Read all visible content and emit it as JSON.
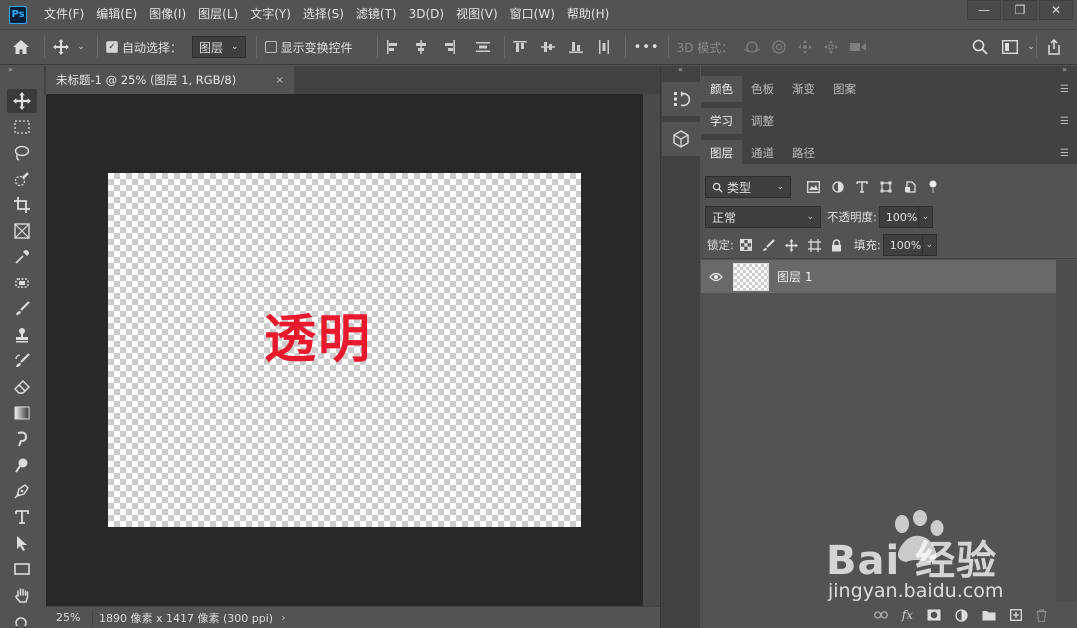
{
  "app": {
    "logo": "Ps"
  },
  "menu": [
    "文件(F)",
    "编辑(E)",
    "图像(I)",
    "图层(L)",
    "文字(Y)",
    "选择(S)",
    "滤镜(T)",
    "3D(D)",
    "视图(V)",
    "窗口(W)",
    "帮助(H)"
  ],
  "window_controls": {
    "minimize": "—",
    "maximize": "❐",
    "close": "✕"
  },
  "options": {
    "auto_select_label": "自动选择：",
    "auto_select_value": "图层",
    "show_transform_label": "显示变换控件",
    "more": "•••",
    "mode_3d_label": "3D 模式："
  },
  "document": {
    "tab_title": "未标题-1 @ 25% (图层 1, RGB/8)",
    "tab_close": "×",
    "canvas_text": "透明",
    "zoom": "25%",
    "doc_info": "1890 像素 x 1417 像素 (300 ppi)",
    "status_arrow": "›"
  },
  "panels": {
    "group1_tabs": [
      "颜色",
      "色板",
      "渐变",
      "图案"
    ],
    "group2_tabs": [
      "学习",
      "调整"
    ],
    "group3_tabs": [
      "图层",
      "通道",
      "路径"
    ],
    "filter_kind": "类型",
    "blend_mode": "正常",
    "opacity_label": "不透明度:",
    "opacity_value": "100%",
    "lock_label": "锁定:",
    "fill_label": "填充:",
    "fill_value": "100%",
    "layers": [
      {
        "name": "图层 1",
        "visible": true
      }
    ]
  },
  "watermark": {
    "main": "Bai  经验",
    "sub": "jingyan.baidu.com"
  },
  "colors": {
    "canvas_text": "#e8192c",
    "ps_blue": "#31a8ff",
    "ps_bg": "#001e36"
  }
}
